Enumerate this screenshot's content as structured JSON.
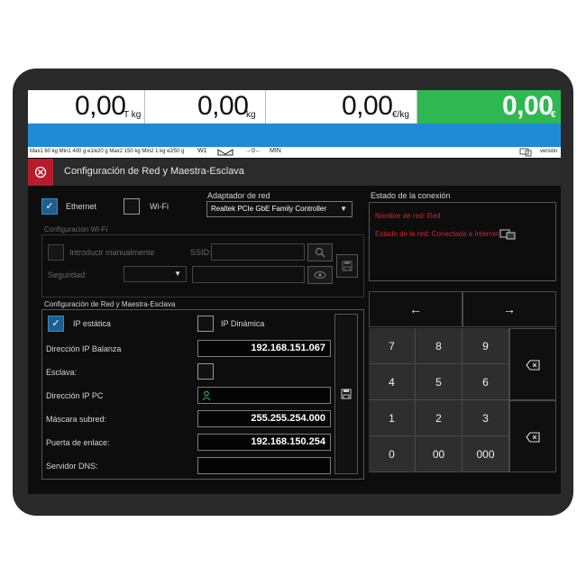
{
  "weights": {
    "tare": {
      "value": "0,00",
      "unit": "T kg"
    },
    "weight": {
      "value": "0,00",
      "unit": "kg"
    },
    "price": {
      "value": "0,00",
      "unit": "€/kg"
    },
    "total": {
      "value": "0,00",
      "unit": "€"
    }
  },
  "status_bar": {
    "capacity": "Max1 60 kg Min1 400 g e1⁄e20 g Max2 150 kg Min2 1 kg e2⁄50 g",
    "w1": "W1",
    "zero": "→0←",
    "min": "MIN",
    "version": "versión"
  },
  "dialog": {
    "title": "Configuración de Red y Maestra-Esclava",
    "ethernet_label": "Ethernet",
    "wifi_label": "Wi-Fi",
    "adapter_label": "Adaptador de red",
    "adapter_value": "Realtek PCIe GbE Family Controller",
    "connection_status_label": "Estado de la conexión",
    "network_name": "Nombre de red: Red",
    "network_status": "Estado de la red: Conectada a Internet",
    "wifi_config_label": "Configuración Wi-Fi",
    "manual_entry_label": "Introducir manualmente",
    "ssid_label": "SSID:",
    "security_label": "Seguridad:",
    "network_config_label": "Configuración de Red y Maestra-Esclava",
    "static_ip_label": "IP estática",
    "dynamic_ip_label": "IP Dinámica",
    "scale_ip_label": "Dirección IP Balanza",
    "scale_ip_value": "192.168.151.067",
    "slave_label": "Esclava:",
    "pc_ip_label": "Dirección IP PC",
    "subnet_label": "Máscara subred:",
    "subnet_value": "255.255.254.000",
    "gateway_label": "Puerta de enlace:",
    "gateway_value": "192.168.150.254",
    "dns_label": "Servidor DNS:"
  },
  "keypad": {
    "left_arrow": "←",
    "right_arrow": "→",
    "keys": [
      "7",
      "8",
      "9",
      "4",
      "5",
      "6",
      "1",
      "2",
      "3",
      "0",
      "00",
      "000"
    ]
  },
  "icons": {
    "close": "close-icon",
    "search": "search-icon",
    "eye": "eye-icon",
    "save": "save-icon",
    "backspace": "backspace-icon",
    "network": "network-icon"
  },
  "colors": {
    "total_bg": "#2fb852",
    "blue_bar": "#1f8ad6",
    "close_bg": "#b71c2b",
    "status_red": "#e02020"
  }
}
